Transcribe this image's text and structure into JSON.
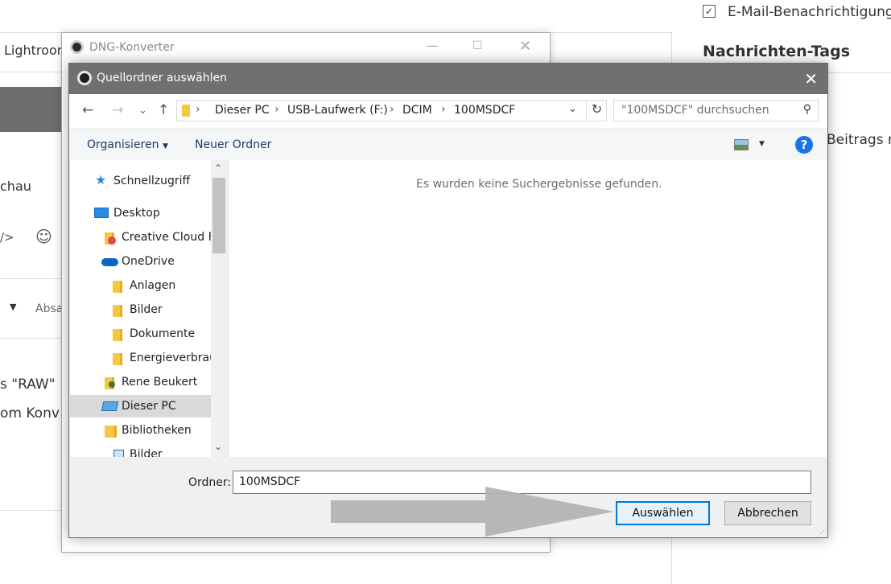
{
  "background": {
    "checkbox_label": "E-Mail-Benachrichtigung",
    "section_title": "Nachrichten-Tags",
    "tab_fragment": "Lightroom",
    "label_vorschau": "chau",
    "code_icon": "/>",
    "emoji_icon": "☺",
    "dropdown_label": "Absa",
    "text_raw": "s \"RAW\"",
    "text_konv": "om Konv",
    "text_beitrags": "Beitrags n"
  },
  "dng_window": {
    "title": "DNG-Konverter"
  },
  "dialog": {
    "title": "Quellordner auswählen",
    "address": {
      "crumbs": [
        "Dieser PC",
        "USB-Laufwerk (F:)",
        "DCIM",
        "100MSDCF"
      ]
    },
    "search_placeholder": "\"100MSDCF\" durchsuchen",
    "toolbar": {
      "organize_label": "Organisieren",
      "new_folder_label": "Neuer Ordner"
    },
    "tree": [
      {
        "label": "Schnellzugriff",
        "icon": "star-icon"
      },
      {
        "label": "Desktop",
        "icon": "desktop-icon"
      },
      {
        "label": "Creative Cloud F",
        "icon": "creative-cloud-folder-icon"
      },
      {
        "label": "OneDrive",
        "icon": "onedrive-icon"
      },
      {
        "label": "Anlagen",
        "icon": "folder-icon"
      },
      {
        "label": "Bilder",
        "icon": "folder-icon"
      },
      {
        "label": "Dokumente",
        "icon": "folder-icon"
      },
      {
        "label": "Energieverbrau",
        "icon": "folder-icon"
      },
      {
        "label": "Rene Beukert",
        "icon": "user-folder-icon"
      },
      {
        "label": "Dieser PC",
        "icon": "computer-icon",
        "selected": true
      },
      {
        "label": "Bibliotheken",
        "icon": "library-icon"
      },
      {
        "label": "Bilder",
        "icon": "pictures-library-icon"
      }
    ],
    "empty_message": "Es wurden keine Suchergebnisse gefunden.",
    "folder_label": "Ordner:",
    "folder_value": "100MSDCF",
    "select_button": "Auswählen",
    "cancel_button": "Abbrechen"
  },
  "colors": {
    "titlebar": "#707070",
    "accent": "#0078d7",
    "help_icon": "#1a73e8",
    "arrow": "#b3b3b3"
  }
}
